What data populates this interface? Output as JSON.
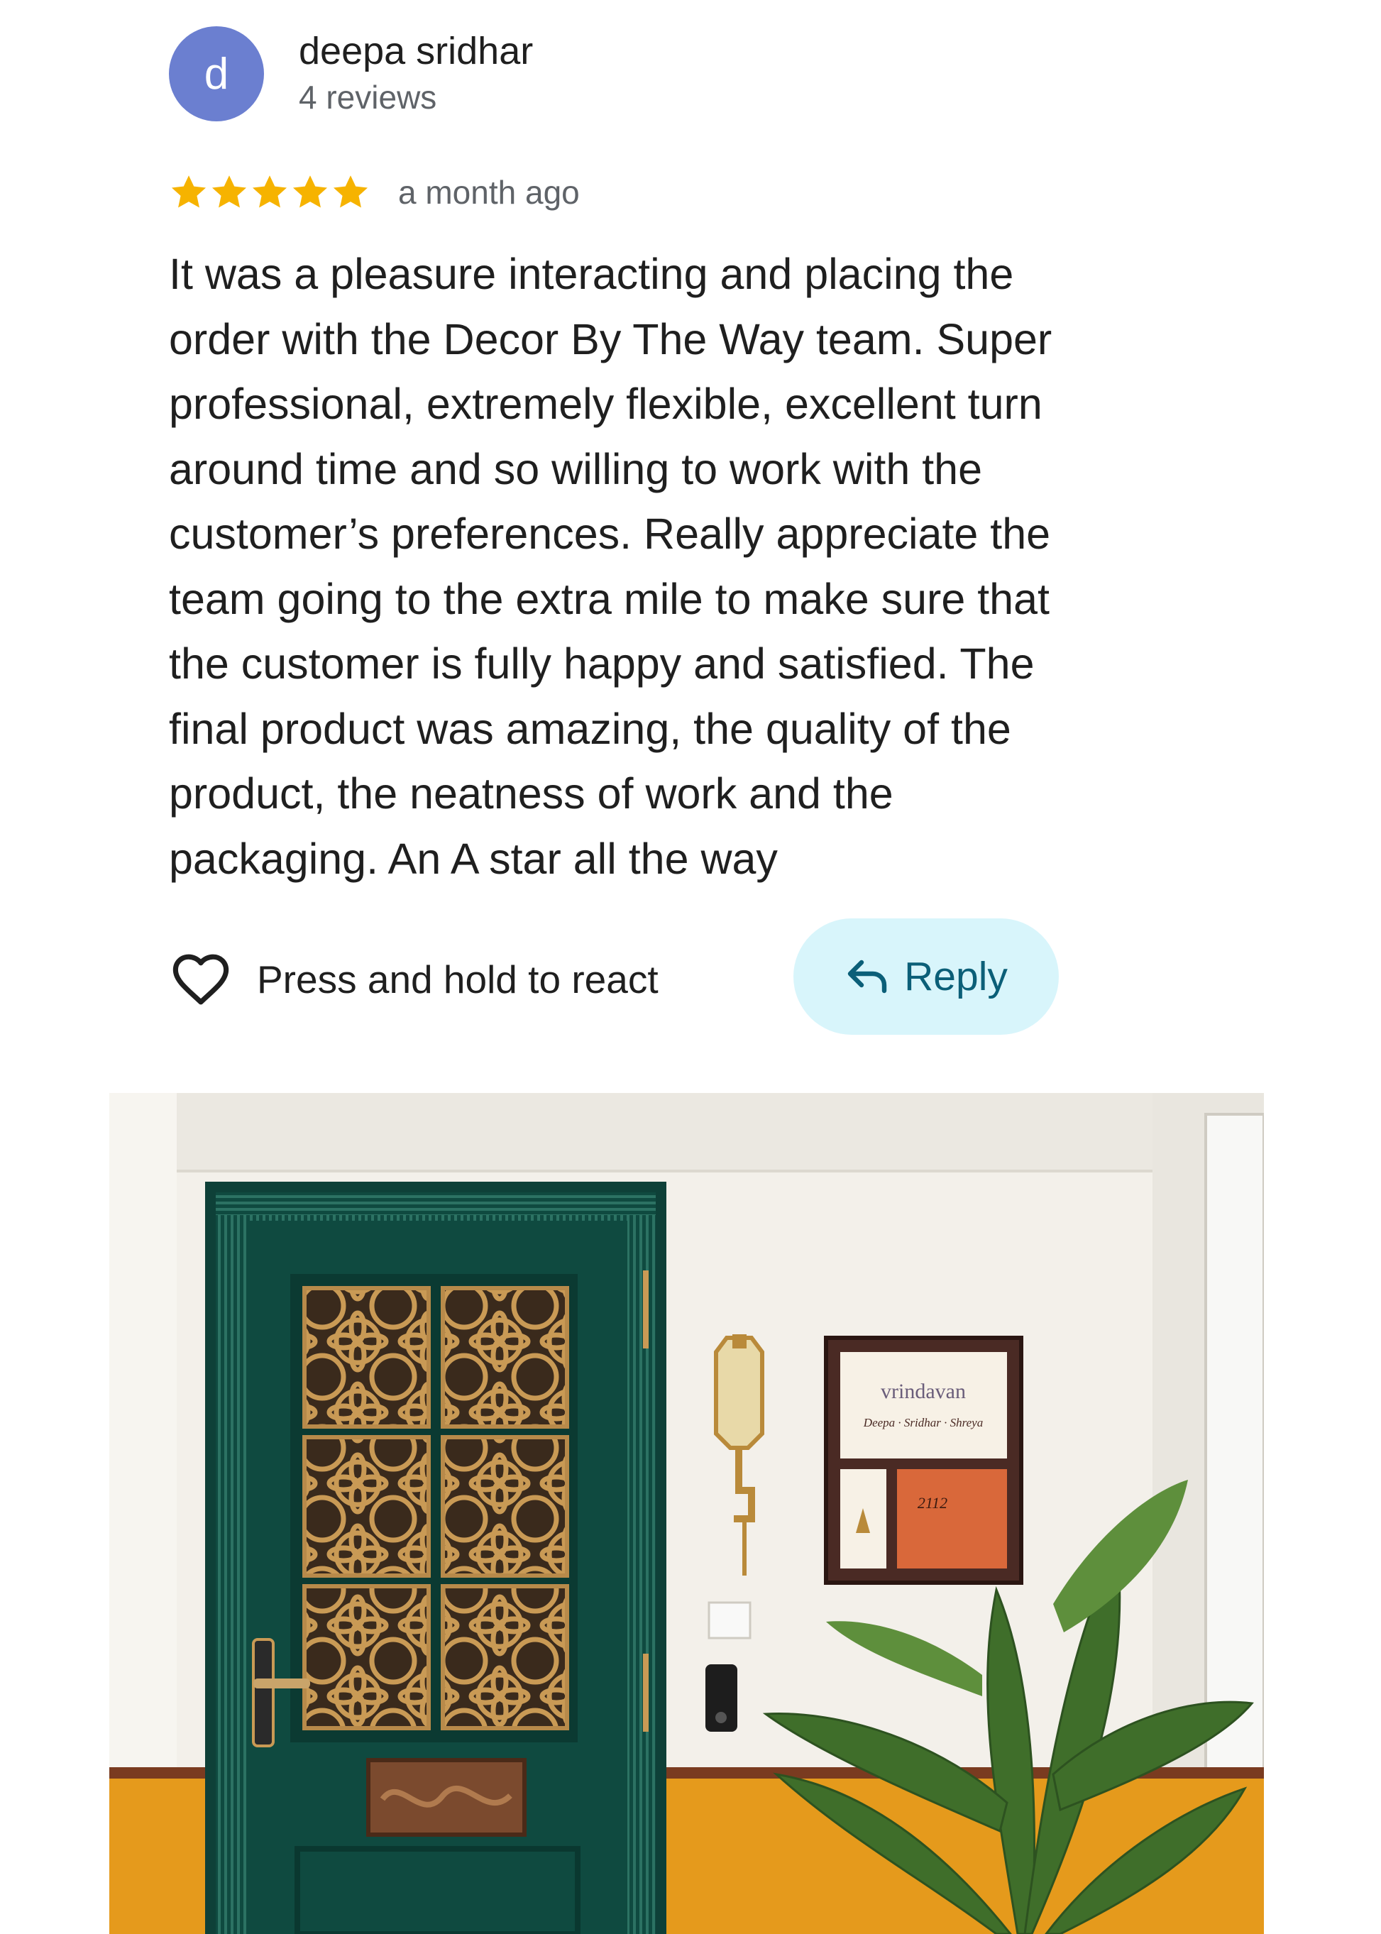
{
  "reviewer": {
    "initial": "d",
    "name": "deepa sridhar",
    "review_count": "4 reviews",
    "avatar_color": "#6b7fd0"
  },
  "review": {
    "rating": 5,
    "max_rating": 5,
    "star_color": "#f6b300",
    "date": "a month ago",
    "text_lines": [
      "It was a pleasure interacting and placing the",
      "order with the Decor By The Way team. Super",
      "professional, extremely flexible, excellent turn",
      "around time and so willing to work with the",
      "customer’s preferences. Really appreciate the",
      "team going to the extra mile to make sure that",
      "the customer is fully happy and satisfied. The",
      "final product was amazing, the quality of the",
      "product, the neatness of work and the",
      "packaging. An A star all the way"
    ]
  },
  "actions": {
    "react_label": "Press and hold to react",
    "react_icon": "heart-outline-icon",
    "reply_label": "Reply",
    "reply_icon": "reply-arrow-icon",
    "reply_bg": "#d8f5fb",
    "reply_color": "#0b5f78"
  },
  "photo": {
    "nameplate": {
      "title": "vrindavan",
      "names": "Deepa · Sridhar · Shreya",
      "number": "2112"
    },
    "colors": {
      "wall": "#f3f0ea",
      "door": "#0f4a40",
      "dado": "#e59a1c",
      "lattice": "#c99a55"
    }
  }
}
